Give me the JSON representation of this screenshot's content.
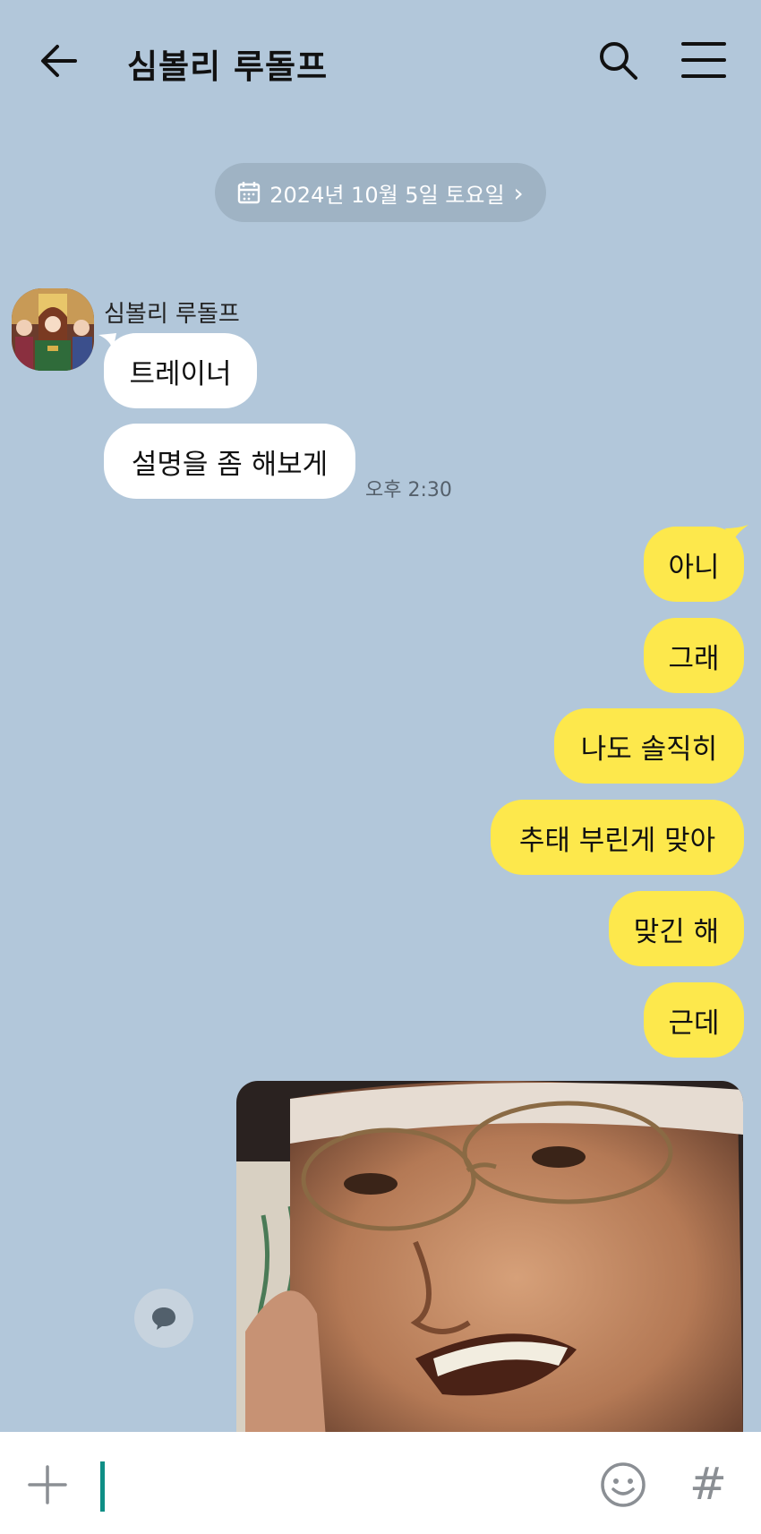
{
  "header": {
    "title": "심볼리 루돌프",
    "back_icon": "arrow-left-icon",
    "search_icon": "search-icon",
    "menu_icon": "hamburger-menu-icon"
  },
  "date_divider": {
    "label": "2024년 10월 5일 토요일",
    "icon": "calendar-icon",
    "chevron": "›"
  },
  "incoming": {
    "sender": "심볼리 루돌프",
    "messages": [
      "트레이너",
      "설명을 좀 해보게"
    ],
    "time": "오후 2:30"
  },
  "outgoing": {
    "messages": [
      "아니",
      "그래",
      "나도 솔직히",
      "추태 부린게 맞아",
      "맞긴 해",
      "근데"
    ],
    "photo": "meme-photo"
  },
  "input": {
    "value": "",
    "placeholder": "",
    "plus_icon": "plus-icon",
    "emoji_icon": "emoji-icon",
    "hash_label": "#"
  },
  "colors": {
    "background": "#b2c7da",
    "outgoing_bubble": "#fde84c",
    "incoming_bubble": "#ffffff",
    "caret": "#0f8f86"
  }
}
